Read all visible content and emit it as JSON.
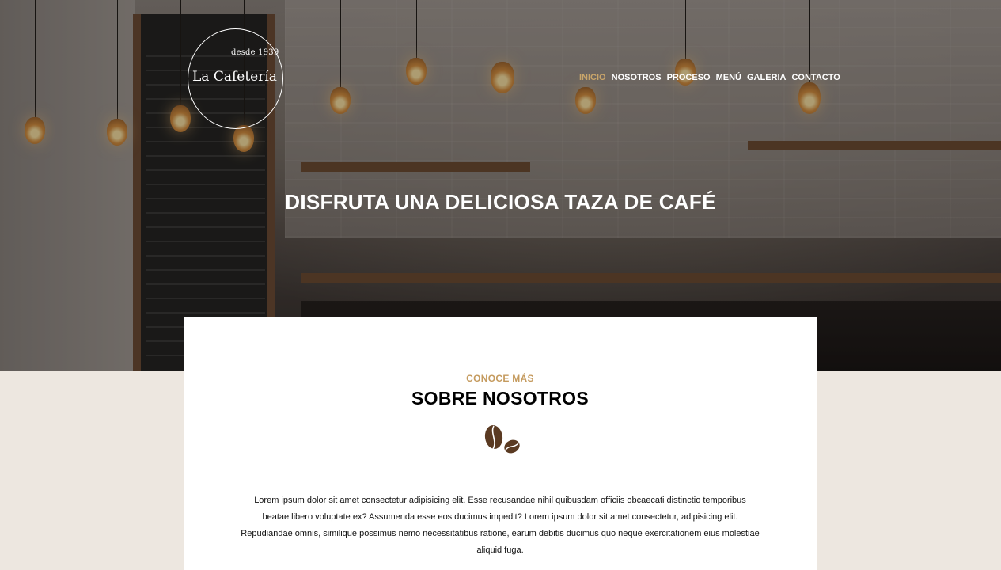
{
  "logo": {
    "since": "desde 1939",
    "name": "La Cafetería"
  },
  "nav": {
    "items": [
      {
        "label": "INICIO",
        "active": true
      },
      {
        "label": "NOSOTROS",
        "active": false
      },
      {
        "label": "PROCESO",
        "active": false
      },
      {
        "label": "MENÚ",
        "active": false
      },
      {
        "label": "GALERIA",
        "active": false
      },
      {
        "label": "CONTACTO",
        "active": false
      }
    ]
  },
  "hero": {
    "title": "DISFRUTA UNA DELICIOSA TAZA DE CAFÉ"
  },
  "about": {
    "eyebrow": "CONOCE MÁS",
    "title": "SOBRE NOSOTROS",
    "icon": "coffee-beans-icon",
    "text": "Lorem ipsum dolor sit amet consectetur adipisicing elit. Esse recusandae nihil quibusdam officiis obcaecati distinctio temporibus beatae libero voluptate ex? Assumenda esse eos ducimus impedit? Lorem ipsum dolor sit amet consectetur, adipisicing elit. Repudiandae omnis, similique possimus nemo necessitatibus ratione, earum debitis ducimus quo neque exercitationem eius molestiae aliquid fuga."
  },
  "colors": {
    "accent": "#c59b5f",
    "bean": "#5a3a22",
    "page_background": "#ede7e0"
  }
}
